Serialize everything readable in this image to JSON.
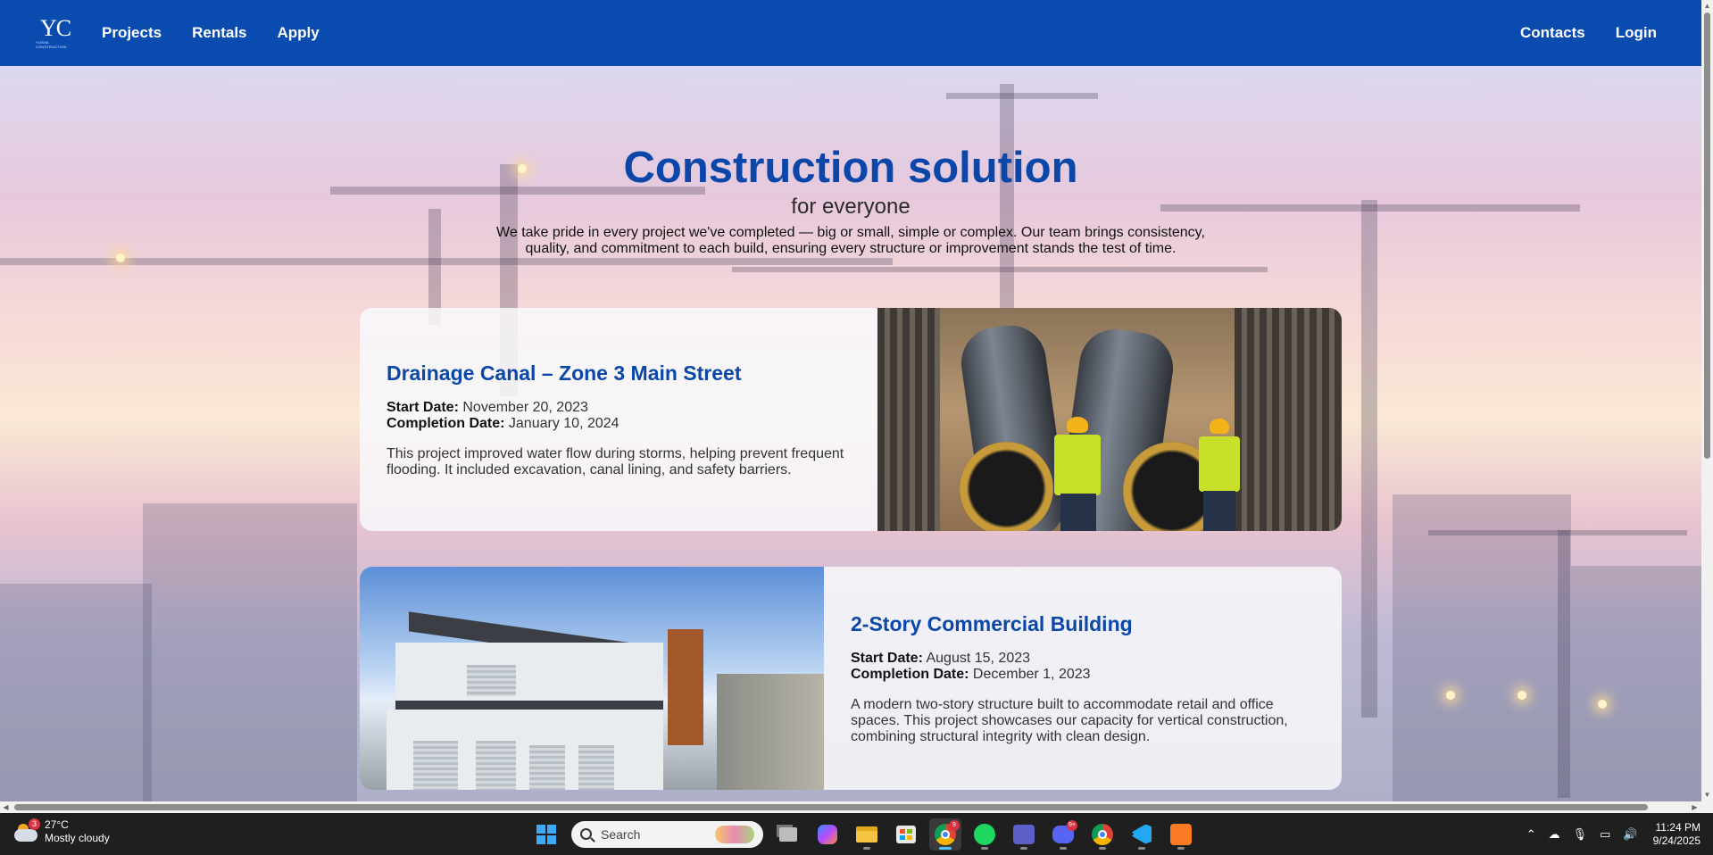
{
  "navbar": {
    "logo_text": "YC",
    "logo_subtext": "YUSHA CONSTRUCTION",
    "links_left": [
      "Projects",
      "Rentals",
      "Apply"
    ],
    "links_right": [
      "Contacts",
      "Login"
    ],
    "background": "#0a4bb0"
  },
  "hero": {
    "title": "Construction solution",
    "subtitle": "for everyone",
    "description": "We take pride in every project we've completed — big or small, simple or complex. Our team brings consistency, quality, and commitment to each build, ensuring every structure or improvement stands the test of time.",
    "title_color": "#0b47a8"
  },
  "projects": [
    {
      "title": "Drainage Canal – Zone 3 Main Street",
      "start_label": "Start Date:",
      "start_value": "November 20, 2023",
      "completion_label": "Completion Date:",
      "completion_value": "January 10, 2024",
      "description": "This project improved water flow during storms, helping prevent frequent flooding. It included excavation, canal lining, and safety barriers."
    },
    {
      "title": "2-Story Commercial Building",
      "start_label": "Start Date:",
      "start_value": "August 15, 2023",
      "completion_label": "Completion Date:",
      "completion_value": "December 1, 2023",
      "description": "A modern two-story structure built to accommodate retail and office spaces. This project showcases our capacity for vertical construction, combining structural integrity with clean design."
    }
  ],
  "taskbar": {
    "weather_badge": "3",
    "weather_temp": "27°C",
    "weather_desc": "Mostly cloudy",
    "search_placeholder": "Search",
    "chrome_badge": "9",
    "discord_badge": "9+",
    "time": "11:24 PM",
    "date": "9/24/2025",
    "apps": [
      "windows-start-icon",
      "search",
      "task-view-icon",
      "copilot-icon",
      "file-explorer-icon",
      "microsoft-store-icon",
      "chrome-icon",
      "spotify-icon",
      "teams-icon",
      "discord-icon",
      "chrome-profile-icon",
      "vscode-icon",
      "xampp-icon"
    ]
  }
}
